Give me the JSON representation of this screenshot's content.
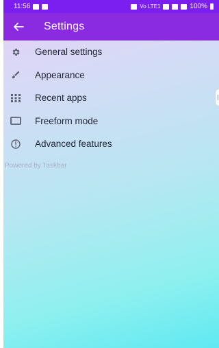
{
  "status_bar": {
    "time": "11:56",
    "network_text": "Vo LTE1",
    "battery_text": "100%"
  },
  "app_bar": {
    "title": "Settings",
    "back_icon": "arrow-left-icon"
  },
  "menu": {
    "items": [
      {
        "label": "General settings",
        "icon": "gear-icon"
      },
      {
        "label": "Appearance",
        "icon": "brush-icon"
      },
      {
        "label": "Recent apps",
        "icon": "grid-icon"
      },
      {
        "label": "Freeform mode",
        "icon": "window-icon"
      },
      {
        "label": "Advanced features",
        "icon": "info-icon"
      }
    ]
  },
  "footer": {
    "text": "Powered by Taskbar"
  },
  "colors": {
    "status_bar": "#7a1ff0",
    "app_bar": "#8a2be2",
    "icon": "#5c6070"
  }
}
